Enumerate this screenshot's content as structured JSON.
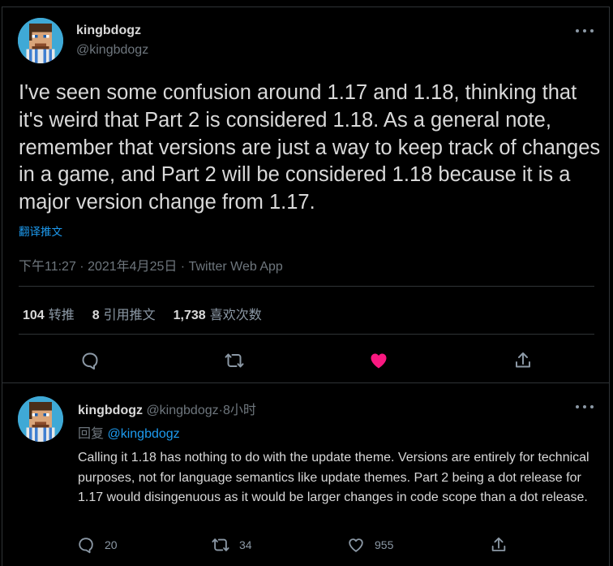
{
  "main_tweet": {
    "display_name": "kingbdogz",
    "handle": "@kingbdogz",
    "text": "I've seen some confusion around 1.17 and 1.18, thinking that it's weird that Part 2 is considered 1.18. As a general note, remember that versions are just a way to keep track of changes in a game, and Part 2 will be considered 1.18 because it is a major version change from 1.17.",
    "translate_label": "翻译推文",
    "timestamp": "下午11:27 · 2021年4月25日 · Twitter Web App",
    "stats": {
      "retweets_count": "104",
      "retweets_label": "转推",
      "quotes_count": "8",
      "quotes_label": "引用推文",
      "likes_count": "1,738",
      "likes_label": "喜欢次数"
    },
    "liked": true
  },
  "reply_tweet": {
    "display_name": "kingbdogz",
    "handle": "@kingbdogz",
    "separator": "·",
    "time_ago": "8小时",
    "replying_prefix": "回复",
    "replying_to": "@kingbdogz",
    "text": "Calling it 1.18 has nothing to do with the update theme. Versions are entirely for technical purposes, not for language semantics like update themes. Part 2 being a dot release for 1.17 would disingenuous as it would be larger changes in code scope than a dot release.",
    "reply_count": "20",
    "retweet_count": "34",
    "like_count": "955"
  },
  "colors": {
    "background": "#000000",
    "text": "#d9d9d9",
    "secondary": "#6e767d",
    "link": "#1d9bf0",
    "like_active": "#f91880",
    "border": "#2f3336"
  },
  "icons": {
    "more": "more-horizontal-icon",
    "reply": "reply-bubble-icon",
    "retweet": "retweet-icon",
    "like": "heart-icon",
    "share": "share-icon"
  }
}
